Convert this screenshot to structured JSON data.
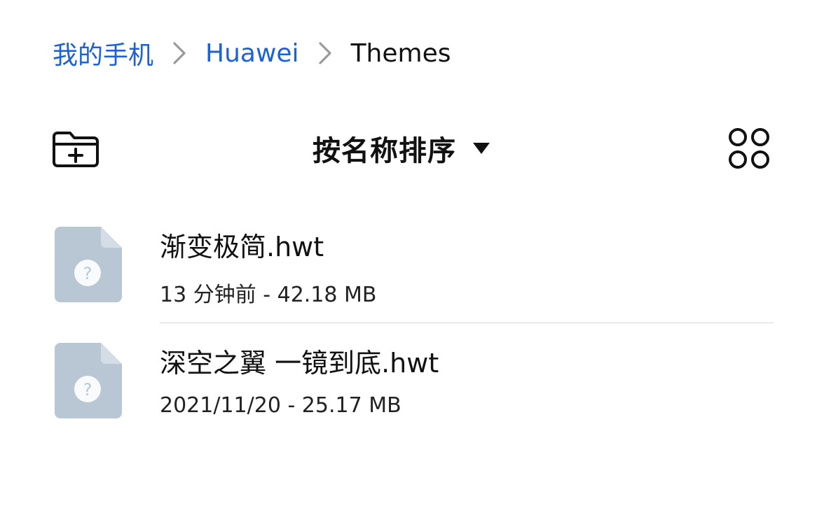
{
  "breadcrumb": {
    "items": [
      {
        "label": "我的手机"
      },
      {
        "label": "Huawei"
      },
      {
        "label": "Themes"
      }
    ]
  },
  "toolbar": {
    "sort_label": "按名称排序"
  },
  "files": [
    {
      "name": "渐变极简.hwt",
      "meta": "13 分钟前 - 42.18 MB"
    },
    {
      "name": "深空之翼 一镜到底.hwt",
      "meta": "2021/11/20 - 25.17 MB"
    }
  ],
  "colors": {
    "link": "#1c62d6",
    "file_icon": "#b9c7d4",
    "file_icon_fold": "#d4dde6"
  },
  "icons": {
    "new_folder": "folder-plus-icon",
    "sort_caret": "caret-down-icon",
    "view_toggle": "grid-view-icon",
    "file": "unknown-file-icon",
    "separator": "chevron-right-icon"
  }
}
